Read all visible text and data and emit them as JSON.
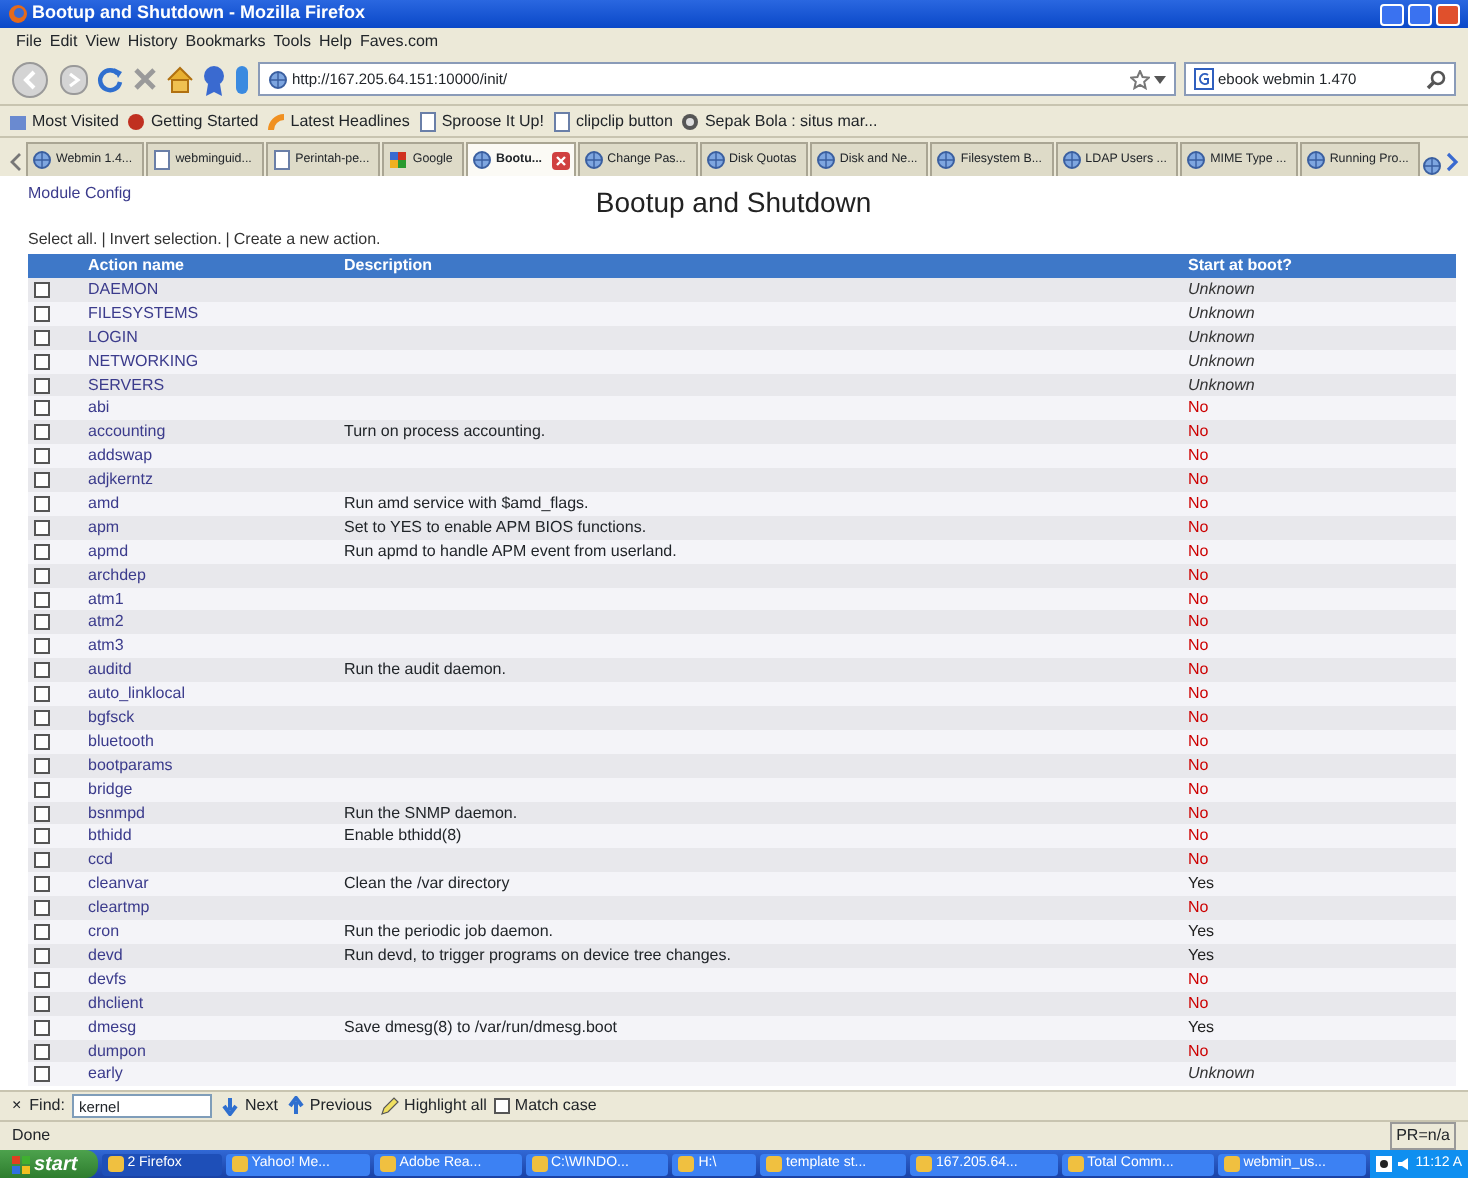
{
  "window": {
    "title": "Bootup and Shutdown - Mozilla Firefox"
  },
  "menu": [
    "File",
    "Edit",
    "View",
    "History",
    "Bookmarks",
    "Tools",
    "Help",
    "Faves.com"
  ],
  "toolbar": {
    "url": "http://167.205.64.151:10000/init/",
    "search": "ebook webmin 1.470"
  },
  "bookmarks": [
    "Most Visited",
    "Getting Started",
    "Latest Headlines",
    "Sproose It Up!",
    "clipclip button",
    "Sepak Bola : situs mar..."
  ],
  "tabs": [
    {
      "label": "Webmin 1.4...",
      "selected": false
    },
    {
      "label": "webminguid...",
      "selected": false
    },
    {
      "label": "Perintah-pe...",
      "selected": false
    },
    {
      "label": "Google",
      "selected": false
    },
    {
      "label": "Bootu...",
      "selected": true
    },
    {
      "label": "Change Pas...",
      "selected": false
    },
    {
      "label": "Disk Quotas",
      "selected": false
    },
    {
      "label": "Disk and Ne...",
      "selected": false
    },
    {
      "label": "Filesystem B...",
      "selected": false
    },
    {
      "label": "LDAP Users ...",
      "selected": false
    },
    {
      "label": "MIME Type ...",
      "selected": false
    },
    {
      "label": "Running Pro...",
      "selected": false
    }
  ],
  "page": {
    "module_config": "Module Config",
    "title": "Bootup and Shutdown",
    "actions": [
      "Select all.",
      "Invert selection.",
      "Create a new action."
    ],
    "separator": "|",
    "columns": [
      "Action name",
      "Description",
      "Start at boot?"
    ],
    "rows": [
      {
        "name": "DAEMON",
        "description": "",
        "boot": "Unknown",
        "color": "#333333",
        "italic": true,
        "checked": false
      },
      {
        "name": "FILESYSTEMS",
        "description": "",
        "boot": "Unknown",
        "color": "#333333",
        "italic": true,
        "checked": false
      },
      {
        "name": "LOGIN",
        "description": "",
        "boot": "Unknown",
        "color": "#333333",
        "italic": true,
        "checked": false
      },
      {
        "name": "NETWORKING",
        "description": "",
        "boot": "Unknown",
        "color": "#333333",
        "italic": true,
        "checked": false
      },
      {
        "name": "SERVERS",
        "description": "",
        "boot": "Unknown",
        "color": "#333333",
        "italic": true,
        "checked": false
      },
      {
        "name": "abi",
        "description": "",
        "boot": "No",
        "color": "#cc0000",
        "italic": false,
        "checked": false
      },
      {
        "name": "accounting",
        "description": "Turn on process accounting.",
        "boot": "No",
        "color": "#cc0000",
        "italic": false,
        "checked": false
      },
      {
        "name": "addswap",
        "description": "",
        "boot": "No",
        "color": "#cc0000",
        "italic": false,
        "checked": false
      },
      {
        "name": "adjkerntz",
        "description": "",
        "boot": "No",
        "color": "#cc0000",
        "italic": false,
        "checked": false
      },
      {
        "name": "amd",
        "description": "Run amd service with $amd_flags.",
        "boot": "No",
        "color": "#cc0000",
        "italic": false,
        "checked": false
      },
      {
        "name": "apm",
        "description": "Set to YES to enable APM BIOS functions.",
        "boot": "No",
        "color": "#cc0000",
        "italic": false,
        "checked": false
      },
      {
        "name": "apmd",
        "description": "Run apmd to handle APM event from userland.",
        "boot": "No",
        "color": "#cc0000",
        "italic": false,
        "checked": false
      },
      {
        "name": "archdep",
        "description": "",
        "boot": "No",
        "color": "#cc0000",
        "italic": false,
        "checked": false
      },
      {
        "name": "atm1",
        "description": "",
        "boot": "No",
        "color": "#cc0000",
        "italic": false,
        "checked": false
      },
      {
        "name": "atm2",
        "description": "",
        "boot": "No",
        "color": "#cc0000",
        "italic": false,
        "checked": false
      },
      {
        "name": "atm3",
        "description": "",
        "boot": "No",
        "color": "#cc0000",
        "italic": false,
        "checked": false
      },
      {
        "name": "auditd",
        "description": "Run the audit daemon.",
        "boot": "No",
        "color": "#cc0000",
        "italic": false,
        "checked": false
      },
      {
        "name": "auto_linklocal",
        "description": "",
        "boot": "No",
        "color": "#cc0000",
        "italic": false,
        "checked": false
      },
      {
        "name": "bgfsck",
        "description": "",
        "boot": "No",
        "color": "#cc0000",
        "italic": false,
        "checked": false
      },
      {
        "name": "bluetooth",
        "description": "",
        "boot": "No",
        "color": "#cc0000",
        "italic": false,
        "checked": false
      },
      {
        "name": "bootparams",
        "description": "",
        "boot": "No",
        "color": "#cc0000",
        "italic": false,
        "checked": false
      },
      {
        "name": "bridge",
        "description": "",
        "boot": "No",
        "color": "#cc0000",
        "italic": false,
        "checked": false
      },
      {
        "name": "bsnmpd",
        "description": "Run the SNMP daemon.",
        "boot": "No",
        "color": "#cc0000",
        "italic": false,
        "checked": false
      },
      {
        "name": "bthidd",
        "description": "Enable bthidd(8)",
        "boot": "No",
        "color": "#cc0000",
        "italic": false,
        "checked": false
      },
      {
        "name": "ccd",
        "description": "",
        "boot": "No",
        "color": "#cc0000",
        "italic": false,
        "checked": false
      },
      {
        "name": "cleanvar",
        "description": "Clean the /var directory",
        "boot": "Yes",
        "color": "#222222",
        "italic": false,
        "checked": false
      },
      {
        "name": "cleartmp",
        "description": "",
        "boot": "No",
        "color": "#cc0000",
        "italic": false,
        "checked": false
      },
      {
        "name": "cron",
        "description": "Run the periodic job daemon.",
        "boot": "Yes",
        "color": "#222222",
        "italic": false,
        "checked": false
      },
      {
        "name": "devd",
        "description": "Run devd, to trigger programs on device tree changes.",
        "boot": "Yes",
        "color": "#222222",
        "italic": false,
        "checked": false
      },
      {
        "name": "devfs",
        "description": "",
        "boot": "No",
        "color": "#cc0000",
        "italic": false,
        "checked": false
      },
      {
        "name": "dhclient",
        "description": "",
        "boot": "No",
        "color": "#cc0000",
        "italic": false,
        "checked": false
      },
      {
        "name": "dmesg",
        "description": "Save dmesg(8) to /var/run/dmesg.boot",
        "boot": "Yes",
        "color": "#222222",
        "italic": false,
        "checked": false
      },
      {
        "name": "dumpon",
        "description": "",
        "boot": "No",
        "color": "#cc0000",
        "italic": false,
        "checked": false
      },
      {
        "name": "early",
        "description": "",
        "boot": "Unknown",
        "color": "#333333",
        "italic": true,
        "checked": false
      }
    ]
  },
  "find_bar": {
    "close": "×",
    "label": "Find:",
    "value": "kernel",
    "buttons": [
      "Next",
      "Previous",
      "Highlight all"
    ],
    "match_case": {
      "label": "Match case",
      "checked": false
    }
  },
  "status_bar": {
    "text": "Done",
    "right": "PR=n/a"
  },
  "taskbar": {
    "start": "start",
    "items": [
      {
        "label": "2 Firefox",
        "selected": true
      },
      {
        "label": "Yahoo! Me...",
        "selected": false
      },
      {
        "label": "Adobe Rea...",
        "selected": false
      },
      {
        "label": "C:\\WINDO...",
        "selected": false
      },
      {
        "label": "H:\\",
        "selected": false
      },
      {
        "label": "template st...",
        "selected": false
      },
      {
        "label": "167.205.64...",
        "selected": false
      },
      {
        "label": "Total Comm...",
        "selected": false
      },
      {
        "label": "webmin_us...",
        "selected": false
      }
    ],
    "clock": "11:12 A"
  }
}
